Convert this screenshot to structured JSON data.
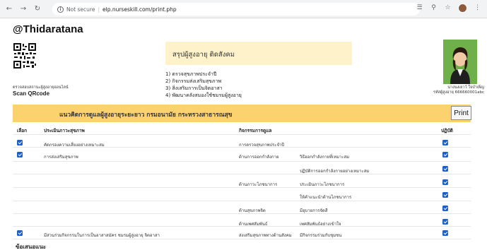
{
  "browser": {
    "security_text": "Not secure",
    "url": "elp.nurseskill.com/print.php"
  },
  "page": {
    "username": "@Thidaratana",
    "qr_caption": "ตรวจสอบสถานะผู้สูงอายุออนไลน์",
    "qr_label": "Scan QRcode",
    "title": "สรุปผู้สูงอายุ ติดสังคม",
    "topics": [
      "1)  ตรวจสุขภาพประจำปี",
      "2)  กิจกรรมส่งเสริมสุขภาพ",
      "3)  สิ่งเสริมการเป็นจิตอาสา",
      "4)  พัฒนาคลังสมองใช้ชมรมผู้สูงอายุ"
    ],
    "profile_name": "นางนงเยาว์ ใจบำเพ็ญ",
    "profile_id": "รหัสผู้สูงอายุ 666660001abc",
    "banner": "แนวคิดการดูแลผู้สูงอายุระยะยาว กรมอนามัย กระทรวงสาธารณสุข",
    "print_label": "Print",
    "suggestion_label": "ข้อเสนอแนะ"
  },
  "table": {
    "headers": {
      "select": "เลือก",
      "assessment": "ประเมินภาวะสุขภาพ",
      "activity": "กิจกรรมการดูแล",
      "practice": "ปฏิบัติ"
    },
    "rows": [
      {
        "select": true,
        "assessment": "คัดกรองความเสี่ยงอย่างเหมาะสม",
        "activity": "การตรวจสุขภาพประจำปี",
        "detail": "",
        "done": true
      },
      {
        "select": true,
        "assessment": "การส่งเสริมสุขภาพ",
        "activity": "ด้านการออกกำลังกาย",
        "detail": "วิธีออกกำลังกายที่เหมาะสม",
        "done": true
      },
      {
        "select": false,
        "assessment": "",
        "activity": "",
        "detail": "ปฏิบัติการออกกำลังกายอย่างเหมาะสม",
        "done": true
      },
      {
        "select": false,
        "assessment": "",
        "activity": "ด้านภาวะโภชนาการ",
        "detail": "ประเมินภาวะโภชนาการ",
        "done": true
      },
      {
        "select": false,
        "assessment": "",
        "activity": "",
        "detail": "ให้คำแนะนำด้านโภชนาการ",
        "done": true
      },
      {
        "select": false,
        "assessment": "",
        "activity": "ด้านสุขภาพจิต",
        "detail": "มีอุบายการจัดสี",
        "done": true
      },
      {
        "select": false,
        "assessment": "",
        "activity": "ด้านเพศสัมพันธ์",
        "detail": "เพศสัมพันธ์อย่างเข้าใจ",
        "done": true
      },
      {
        "select": true,
        "assessment": "มีส่วนร่วมกิจกรรมในการเป็นอาสาสมัคร ชมรมผู้สูงอายุ จิตอาสา",
        "activity": "ส่งเสริมสุขภาพทางด้านสังคม",
        "detail": "มีกิจกรรมร่วมกับชุมชน",
        "done": true
      }
    ]
  },
  "colors": {
    "title_bg": "#fdf2c9",
    "banner_bg": "#fcd26e",
    "checkbox": "#1e5fd0",
    "profile_bg": "#6fb04a"
  }
}
